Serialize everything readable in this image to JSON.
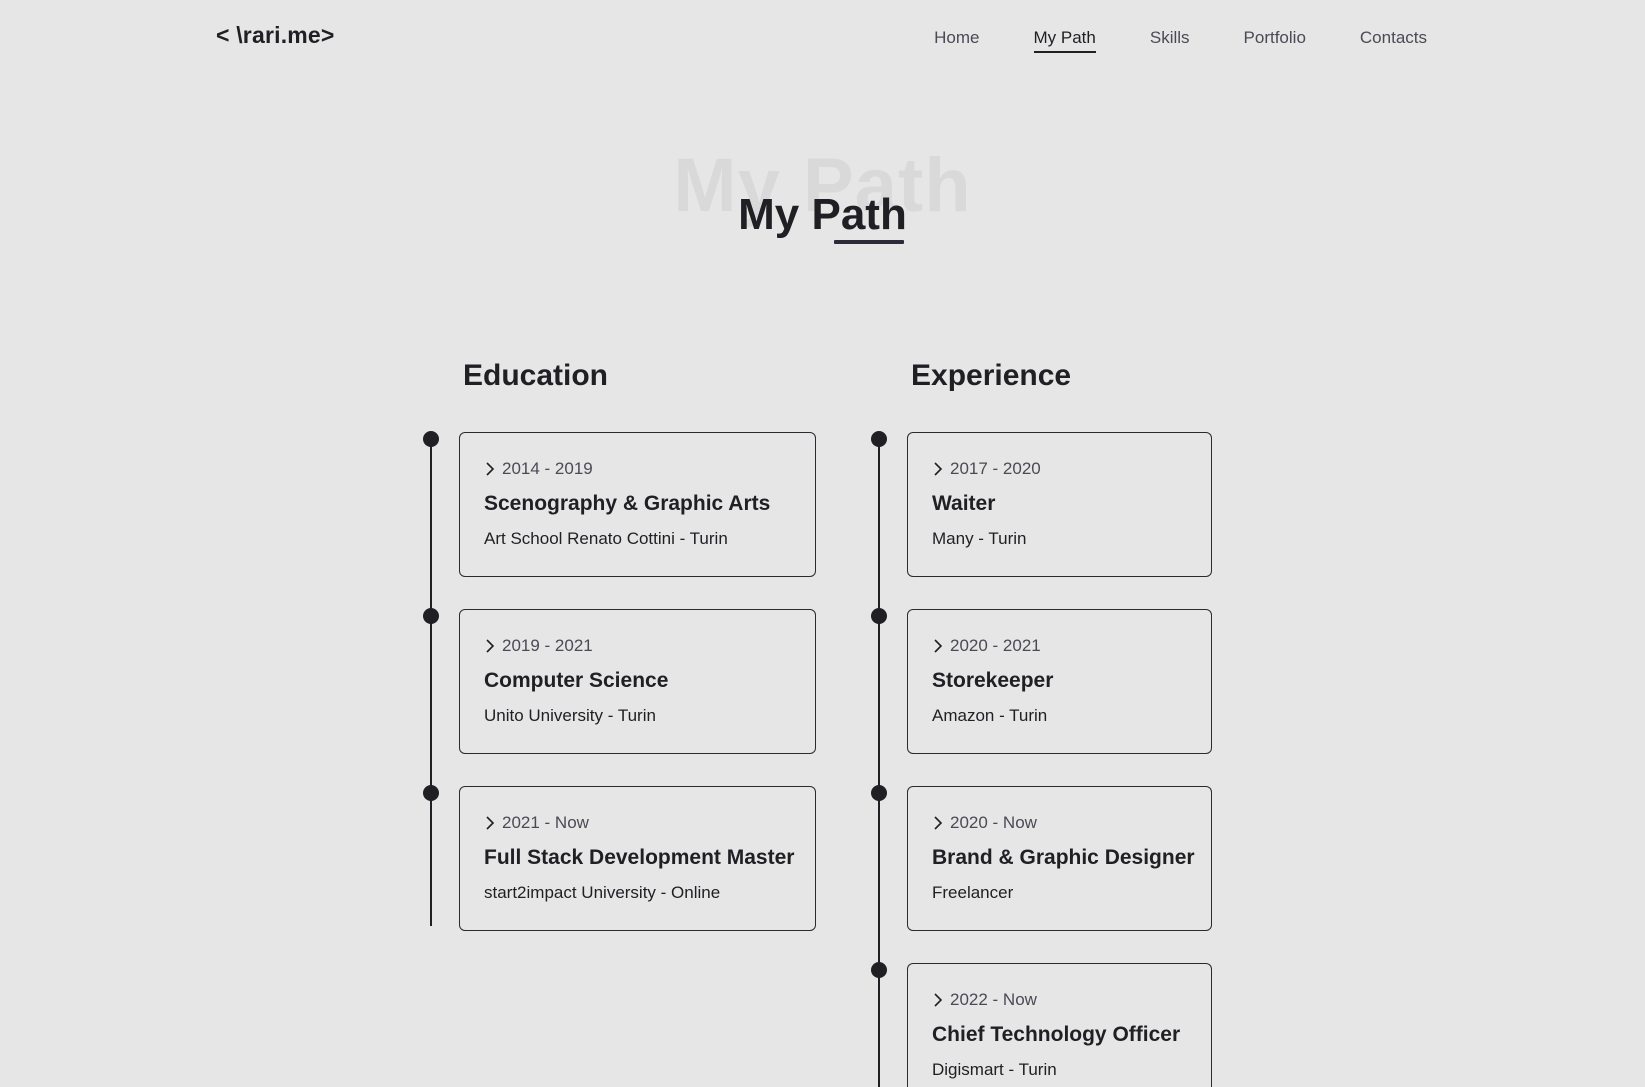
{
  "header": {
    "logo": "< \\rari.me>",
    "nav": [
      {
        "label": "Home",
        "active": false
      },
      {
        "label": "My Path",
        "active": true
      },
      {
        "label": "Skills",
        "active": false
      },
      {
        "label": "Portfolio",
        "active": false
      },
      {
        "label": "Contacts",
        "active": false
      }
    ]
  },
  "title": {
    "background": "My Path",
    "foreground": "My Path"
  },
  "education": {
    "heading": "Education",
    "items": [
      {
        "period": "2014 - 2019",
        "title": "Scenography & Graphic Arts",
        "place": "Art School Renato Cottini - Turin"
      },
      {
        "period": "2019 - 2021",
        "title": "Computer Science",
        "place": "Unito University - Turin"
      },
      {
        "period": "2021 - Now",
        "title": "Full Stack Development Master",
        "place": "start2impact University - Online"
      }
    ]
  },
  "experience": {
    "heading": "Experience",
    "items": [
      {
        "period": "2017 - 2020",
        "title": "Waiter",
        "place": "Many - Turin"
      },
      {
        "period": "2020 - 2021",
        "title": "Storekeeper",
        "place": "Amazon - Turin"
      },
      {
        "period": "2020 - Now",
        "title": "Brand & Graphic Designer",
        "place": "Freelancer"
      },
      {
        "period": "2022 - Now",
        "title": "Chief Technology Officer",
        "place": "Digismart - Turin"
      }
    ]
  },
  "icons": {
    "period": "chevron-right-icon",
    "timeline": "timeline-dot"
  },
  "colors": {
    "background": "#e6e6e6",
    "text": "#1f1f24",
    "muted": "#4a4a55"
  }
}
